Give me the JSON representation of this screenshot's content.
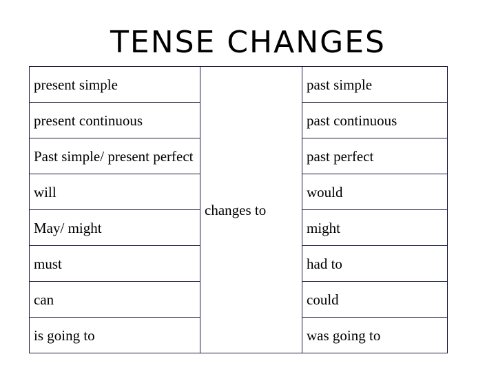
{
  "title": "TENSE CHANGES",
  "connector": "changes to",
  "rows": [
    {
      "from": "present simple",
      "to": "past simple"
    },
    {
      "from": "present continuous",
      "to": "past continuous"
    },
    {
      "from": "Past simple/ present perfect",
      "to": "past perfect"
    },
    {
      "from": "will",
      "to": "would"
    },
    {
      "from": "May/ might",
      "to": "might"
    },
    {
      "from": "must",
      "to": "had to"
    },
    {
      "from": "can",
      "to": "could"
    },
    {
      "from": "is going to",
      "to": "was going to"
    }
  ]
}
